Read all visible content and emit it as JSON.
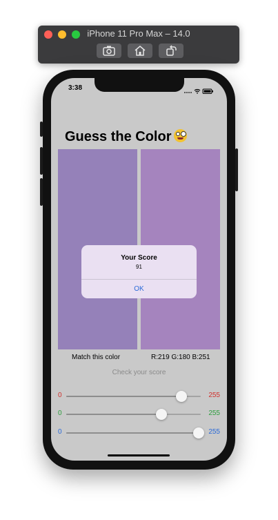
{
  "simulator": {
    "title": "iPhone 11 Pro Max – 14.0",
    "buttons": [
      "screenshot-icon",
      "home-icon",
      "rotate-icon"
    ]
  },
  "status_bar": {
    "time": "3:38",
    "icons": [
      "cellular-icon",
      "wifi-icon",
      "battery-icon"
    ]
  },
  "app": {
    "title": "Guess the Color",
    "title_emoji": "zany-face-emoji",
    "target_color": "#9581b9",
    "guess_color": "#a584be",
    "target_label": "Match this color",
    "guess_label": "R:219 G:180 B:251",
    "check_button": "Check your score",
    "sliders": [
      {
        "name": "red",
        "min": "0",
        "max": "255",
        "value": 219,
        "color": "#d0312d"
      },
      {
        "name": "green",
        "min": "0",
        "max": "255",
        "value": 180,
        "color": "#2e9e3f"
      },
      {
        "name": "blue",
        "min": "0",
        "max": "255",
        "value": 251,
        "color": "#2a6ad8"
      }
    ]
  },
  "alert": {
    "title": "Your Score",
    "message": "91",
    "button": "OK"
  }
}
